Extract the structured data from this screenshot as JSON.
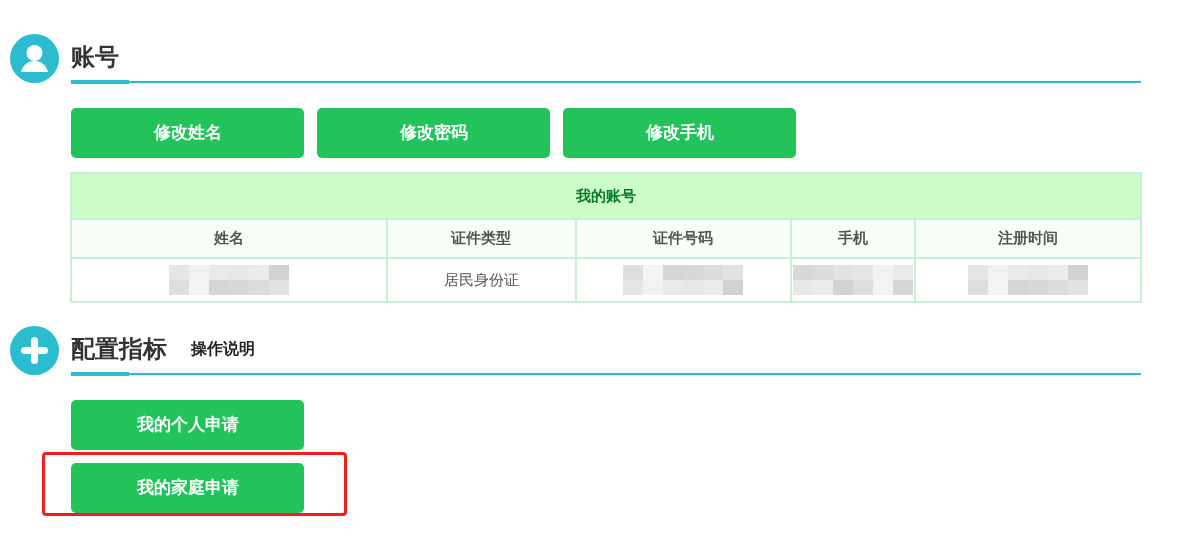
{
  "sections": [
    {
      "kind": "account",
      "title": "账号",
      "buttons": [
        {
          "label": "修改姓名",
          "highlighted": false
        },
        {
          "label": "修改密码",
          "highlighted": false
        },
        {
          "label": "修改手机",
          "highlighted": false
        }
      ],
      "table": {
        "caption": "我的账号",
        "columns": [
          "姓名",
          "证件类型",
          "证件号码",
          "手机",
          "注册时间"
        ],
        "rows": [
          [
            {
              "kind": "redacted"
            },
            {
              "kind": "text",
              "text": "居民身份证"
            },
            {
              "kind": "redacted"
            },
            {
              "kind": "redacted"
            },
            {
              "kind": "redacted"
            }
          ]
        ]
      }
    },
    {
      "kind": "config",
      "title": "配置指标",
      "subtitle": "操作说明",
      "buttons": [
        {
          "label": "我的个人申请",
          "highlighted": false
        },
        {
          "label": "我的家庭申请",
          "highlighted": true
        }
      ]
    }
  ]
}
